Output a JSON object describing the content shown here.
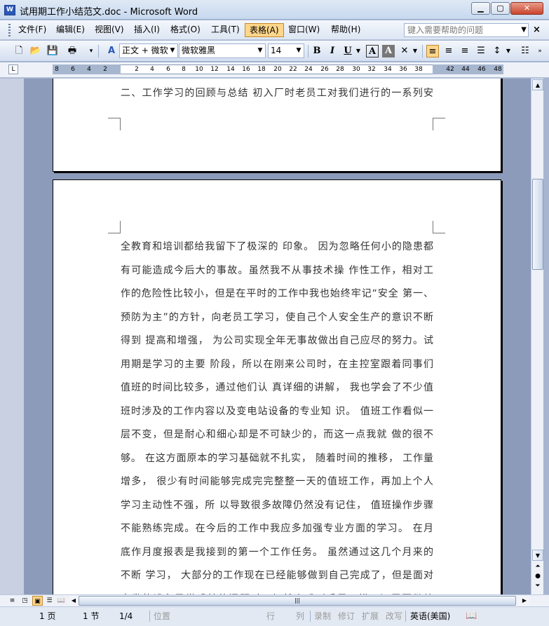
{
  "window": {
    "title": "试用期工作小结范文.doc - Microsoft Word",
    "app_icon": "W"
  },
  "menu": {
    "items": [
      "文件(F)",
      "编辑(E)",
      "视图(V)",
      "插入(I)",
      "格式(O)",
      "工具(T)",
      "表格(A)",
      "窗口(W)",
      "帮助(H)"
    ],
    "active_index": 6,
    "help_placeholder": "键入需要帮助的问题"
  },
  "toolbar": {
    "style": "正文 + 微软",
    "font": "微软雅黑",
    "size": "14",
    "bold": "B",
    "italic": "I",
    "underline": "U",
    "char_border": "A",
    "char_shading": "A"
  },
  "ruler": {
    "numbers": [
      "8",
      "6",
      "4",
      "2",
      "2",
      "4",
      "6",
      "8",
      "10",
      "12",
      "14",
      "16",
      "18",
      "20",
      "22",
      "24",
      "26",
      "28",
      "30",
      "32",
      "34",
      "36",
      "38",
      "42",
      "44",
      "46",
      "48"
    ]
  },
  "document": {
    "page1_lines": [
      "二、工作学习的回顾与总结 初入厂时老员工对我们进行的一系列安"
    ],
    "page2_lines": [
      "全教育和培训都给我留下了极深的 印象。 因为忽略任何小的隐患都",
      "有可能造成今后大的事故。虽然我不从事技术操 作性工作，相对工",
      "作的危险性比较小，但是在平时的工作中我也始终牢记“安全 第一、",
      "预防为主”的方针，向老员工学习，使自己个人安全生产的意识不断",
      "得到 提高和增强， 为公司实现全年无事故做出自己应尽的努力。试",
      "用期是学习的主要 阶段，所以在刚来公司时，在主控室跟着同事们",
      "值班的时间比较多，通过他们认 真详细的讲解， 我也学会了不少值",
      "班时涉及的工作内容以及变电站设备的专业知 识。 值班工作看似一",
      "层不变，但是耐心和细心却是不可缺少的，而这一点我就 做的很不",
      "够。 在这方面原本的学习基础就不扎实， 随着时间的推移， 工作量",
      "增多， 很少有时间能够完成完完整整一天的值班工作，再加上个人",
      "学习主动性不强，所 以导致很多故障仍然没有记住， 值班操作步骤",
      "不能熟练完成。在今后的工作中我应多加强专业方面的学习。 在月",
      "底作月度报表是我接到的第一个工作任务。 虽然通过这几个月来的",
      "不断 学习， 大部分的工作现在已经能够做到自己完成了，但是面对",
      "突发的设备异常或其他问题时，仍然会感到手足无措，还需要继续"
    ]
  },
  "status": {
    "page": "1 页",
    "section": "1 节",
    "pages": "1/4",
    "position": "位置",
    "line": "行",
    "col": "列",
    "rec": "录制",
    "trk": "修订",
    "ext": "扩展",
    "ovr": "改写",
    "lang": "英语(美国)"
  }
}
